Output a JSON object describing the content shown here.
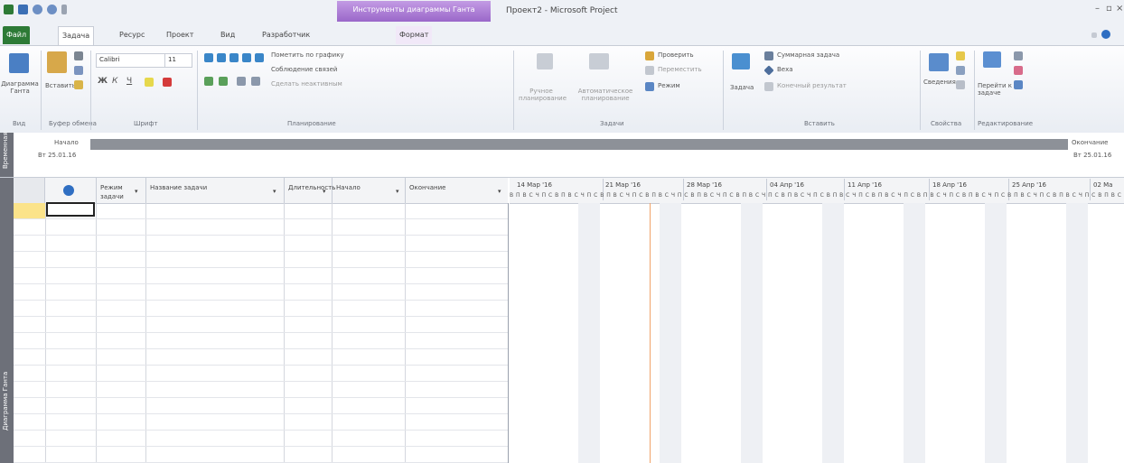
{
  "titlebar": {
    "context_group": "Инструменты диаграммы Ганта",
    "window_title": "Проект2 - Microsoft Project"
  },
  "tabs": [
    {
      "label": "Файл"
    },
    {
      "label": "Задача"
    },
    {
      "label": "Ресурс"
    },
    {
      "label": "Проект"
    },
    {
      "label": "Вид"
    },
    {
      "label": "Разработчик"
    },
    {
      "label": "Формат"
    }
  ],
  "ribbon": {
    "view": {
      "button": "Диаграмма Ганта",
      "group": "Вид"
    },
    "clipboard": {
      "paste": "Вставить",
      "group": "Буфер обмена"
    },
    "font": {
      "font_name": "Calibri",
      "font_size": "11",
      "bold": "Ж",
      "italic": "К",
      "underline": "Ч",
      "group": "Шрифт"
    },
    "schedule": {
      "mark_on_track": "Пометить по графику",
      "respect_links": "Соблюдение связей",
      "inactivate": "Сделать неактивным",
      "group": "Планирование"
    },
    "tasks": {
      "manual": "Ручное планирование",
      "auto": "Автоматическое планирование",
      "inspect": "Проверить",
      "move": "Переместить",
      "mode": "Режим",
      "group": "Задачи"
    },
    "insert": {
      "task": "Задача",
      "summary": "Суммарная задача",
      "milestone": "Веха",
      "deliverable": "Конечный результат",
      "group": "Вставить"
    },
    "properties": {
      "info": "Сведения",
      "group": "Свойства"
    },
    "editing": {
      "goto": "Перейти к задаче",
      "group": "Редактирование"
    }
  },
  "timeline": {
    "side_label": "Временная",
    "start_label": "Начало",
    "start_date": "Вт 25.01.16",
    "end_label": "Окончание",
    "end_date": "Вт 25.01.16"
  },
  "view_side_label": "Диаграмма Ганта",
  "grid": {
    "columns": [
      "Режим задачи",
      "Название задачи",
      "Длительность",
      "Начало",
      "Окончание"
    ]
  },
  "chart": {
    "weeks": [
      "14 Мар '16",
      "21 Мар '16",
      "28 Мар '16",
      "04 Апр '16",
      "11 Апр '16",
      "18 Апр '16",
      "25 Апр '16",
      "02 Ма"
    ],
    "day_letters": "В П В С Ч П С"
  }
}
